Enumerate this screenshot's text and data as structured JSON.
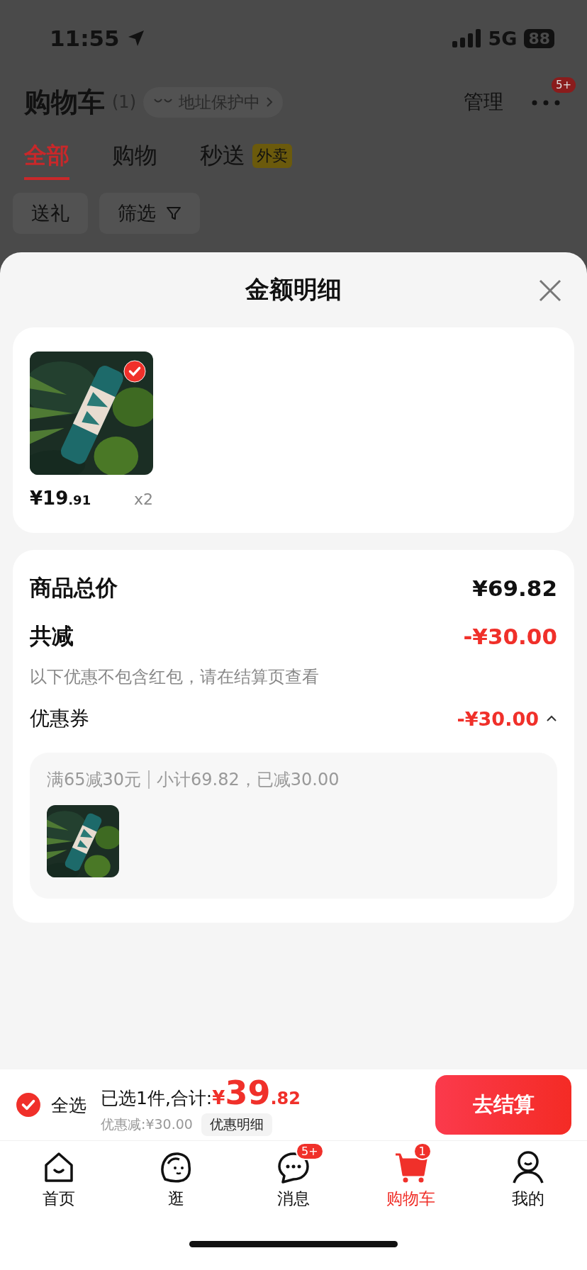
{
  "status_bar": {
    "time": "11:55",
    "network": "5G",
    "battery": "88"
  },
  "header": {
    "title": "购物车",
    "count": "(1)",
    "address_badge": "地址保护中",
    "manage": "管理",
    "more_badge": "5+"
  },
  "tabs": [
    {
      "label": "全部",
      "selected": true
    },
    {
      "label": "购物",
      "selected": false
    },
    {
      "label": "秒送",
      "selected": false,
      "tag": "外卖"
    }
  ],
  "filters": [
    {
      "label": "送礼",
      "kind": "plain"
    },
    {
      "label": "筛选",
      "kind": "filter"
    }
  ],
  "sheet": {
    "title": "金额明细",
    "items": [
      {
        "kind": "picture",
        "price_main": "¥19",
        "price_decimal": ".91",
        "quantity": "x2",
        "checked": true
      }
    ],
    "summary": {
      "total_label": "商品总价",
      "total_value": "¥69.82",
      "discount_label": "共减",
      "discount_value": "-¥30.00",
      "discount_note": "以下优惠不包含红包，请在结算页查看",
      "coupon_label": "优惠券",
      "coupon_value": "-¥30.00",
      "coupon_expanded": true,
      "coupon_detail": {
        "rule": "满65减30元",
        "subtotal": "小计69.82，已减30.00"
      }
    }
  },
  "checkout": {
    "select_all": {
      "label": "全选",
      "checked": true
    },
    "selected_text": "已选1件,合计:",
    "currency": "¥",
    "total_main": "39",
    "total_decimal": ".82",
    "discount_text": "优惠减:¥30.00",
    "detail_button": "优惠明细",
    "checkout_button": "去结算"
  },
  "nav": {
    "items": [
      {
        "label": "首页",
        "kind": "home",
        "selected": false
      },
      {
        "label": "逛",
        "kind": "face",
        "selected": false
      },
      {
        "label": "消息",
        "kind": "chat",
        "selected": false,
        "badge": "5+"
      },
      {
        "label": "购物车",
        "kind": "cart",
        "selected": true,
        "badge": "1"
      },
      {
        "label": "我的",
        "kind": "person",
        "selected": false
      }
    ]
  }
}
